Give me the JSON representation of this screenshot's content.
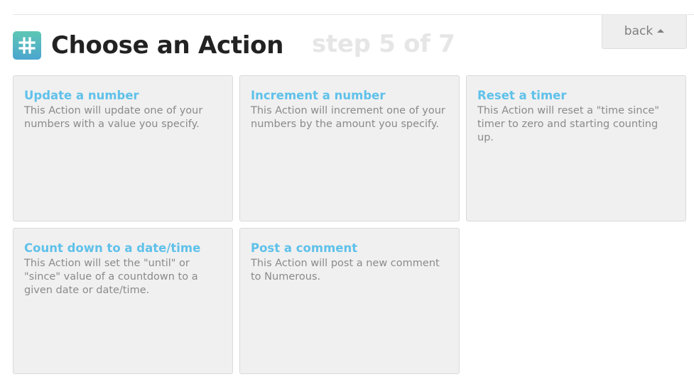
{
  "header": {
    "title": "Choose an Action",
    "step": "step 5 of 7",
    "icon": "hashtag-icon",
    "icon_colors": [
      "#5ec7b4",
      "#4ba6cf"
    ]
  },
  "back_button": {
    "label": "back",
    "icon": "caret-up-icon"
  },
  "colors": {
    "card_title": "#5fc1ea",
    "card_text": "#8a8a8a",
    "card_background": "#f0f0f0"
  },
  "actions": [
    {
      "title": "Update a number",
      "description": "This Action will update one of your numbers with a value you specify."
    },
    {
      "title": "Increment a number",
      "description": "This Action will increment one of your numbers by the amount you specify."
    },
    {
      "title": "Reset a timer",
      "description": "This Action will reset a \"time since\" timer to zero and starting counting up."
    },
    {
      "title": "Count down to a date/time",
      "description": "This Action will set the \"until\" or \"since\" value of a countdown to a given date or date/time."
    },
    {
      "title": "Post a comment",
      "description": "This Action will post a new comment to Numerous."
    }
  ]
}
